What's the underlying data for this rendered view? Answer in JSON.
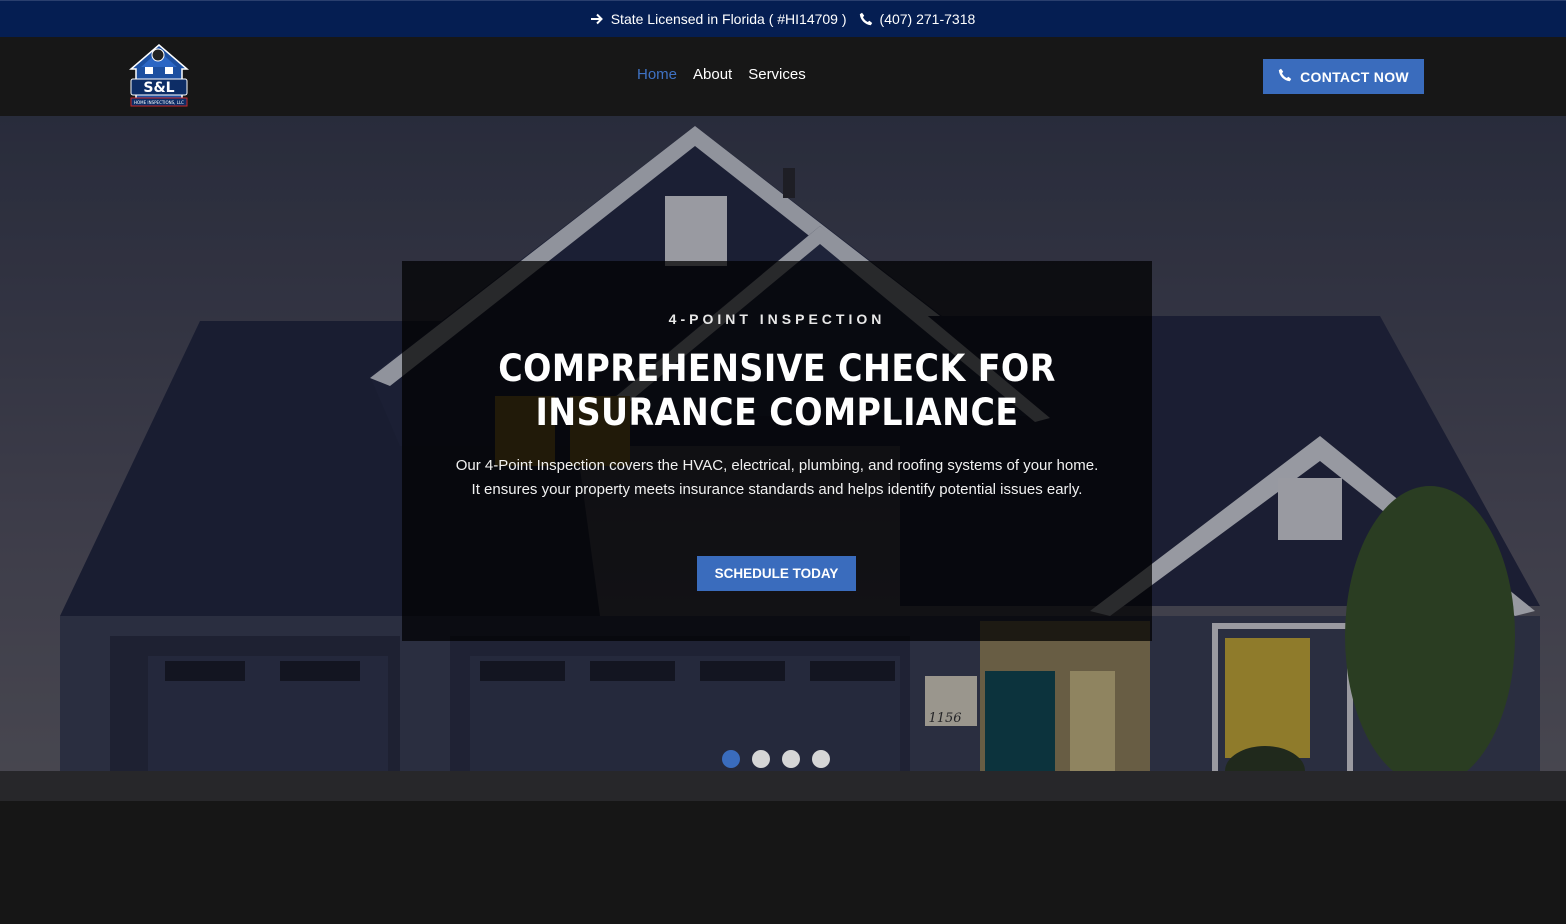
{
  "topbar": {
    "license_text": "State Licensed in Florida ( #HI14709 )",
    "phone_text": "(407) 271-7318"
  },
  "header": {
    "logo_text": "S&L",
    "logo_subtext": "HOME INSPECTIONS, LLC",
    "nav": [
      {
        "label": "Home",
        "active": true
      },
      {
        "label": "About",
        "active": false
      },
      {
        "label": "Services",
        "active": false
      }
    ],
    "contact_button": "CONTACT NOW"
  },
  "hero": {
    "eyebrow": "4-POINT INSPECTION",
    "headline": "COMPREHENSIVE CHECK FOR INSURANCE COMPLIANCE",
    "description": "Our 4-Point Inspection covers the HVAC, electrical, plumbing, and roofing systems of your home. It ensures your property meets insurance standards and helps identify potential issues early.",
    "cta": "SCHEDULE TODAY",
    "house_number": "1156",
    "slides_total": 4,
    "active_slide": 1
  },
  "icons": {
    "license": "arrow-right-icon",
    "phone": "phone-icon"
  },
  "colors": {
    "topbar_bg": "#051e52",
    "accent": "#3a6cbd",
    "header_bg": "#171717",
    "nav_active": "#3f72c3"
  }
}
